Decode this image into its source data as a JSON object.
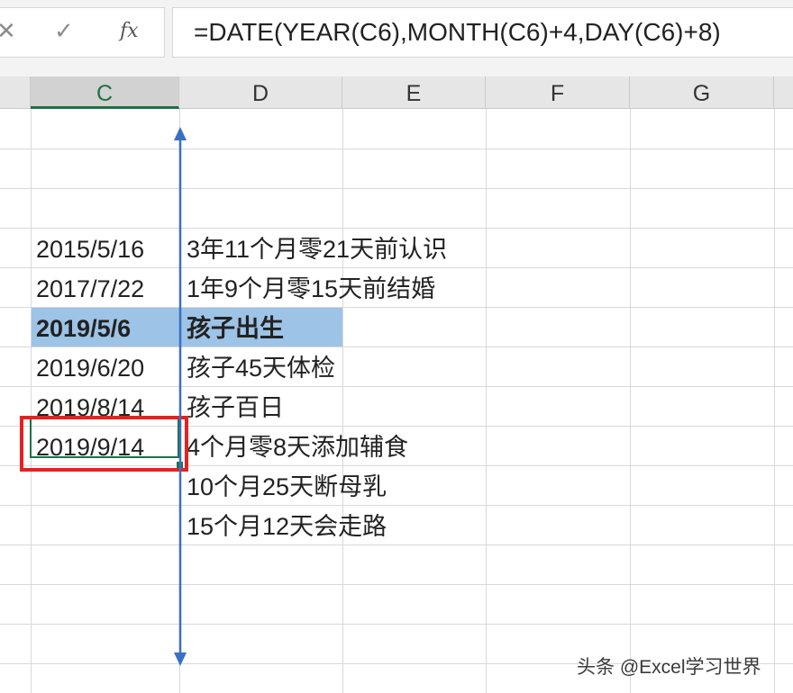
{
  "formula_bar": {
    "cancel_icon": "close-icon",
    "confirm_icon": "check-icon",
    "fx_label": "fx",
    "formula": "=DATE(YEAR(C6),MONTH(C6)+4,DAY(C6)+8)"
  },
  "columns": [
    "C",
    "D",
    "E",
    "F",
    "G"
  ],
  "selected_column": "C",
  "rows": [
    {
      "date": "2015/5/16",
      "event": "3年11个月零21天前认识"
    },
    {
      "date": "2017/7/22",
      "event": "1年9个月零15天前结婚"
    },
    {
      "date": "2019/5/6",
      "event": "孩子出生",
      "highlighted": true
    },
    {
      "date": "2019/6/20",
      "event": "孩子45天体检"
    },
    {
      "date": "2019/8/14",
      "event": "孩子百日"
    },
    {
      "date": "2019/9/14",
      "event": "4个月零8天添加辅食",
      "active": true
    },
    {
      "date": "",
      "event": "10个月25天断母乳"
    },
    {
      "date": "",
      "event": "15个月12天会走路"
    }
  ],
  "colors": {
    "highlight": "#9dc3e6",
    "annotation_red": "#e52222",
    "arrow_blue": "#3a6fc4",
    "excel_green": "#1e7145"
  },
  "watermark": "头条 @Excel学习世界"
}
